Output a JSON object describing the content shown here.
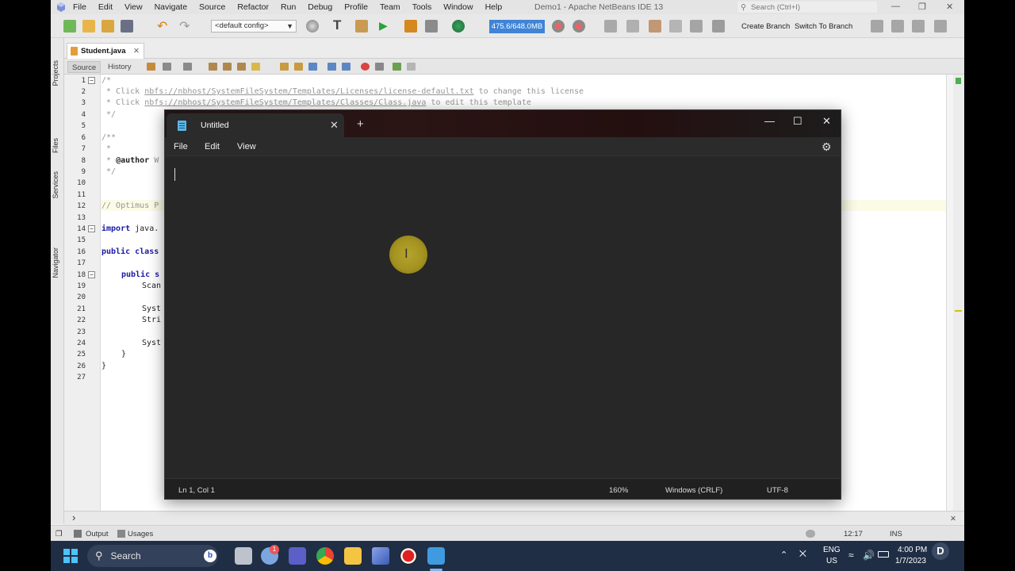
{
  "netbeans": {
    "menus": [
      "File",
      "Edit",
      "View",
      "Navigate",
      "Source",
      "Refactor",
      "Run",
      "Debug",
      "Profile",
      "Team",
      "Tools",
      "Window",
      "Help"
    ],
    "window_title": "Demo1 - Apache NetBeans IDE 13",
    "search_placeholder": "Search (Ctrl+I)",
    "config": "<default config>",
    "memory": "475.6/648.0MB",
    "create_branch": "Create Branch",
    "switch_branch": "Switch To Branch",
    "side_tabs": [
      "Projects",
      "Files",
      "Services",
      "Navigator"
    ],
    "file_tab": "Student.java",
    "source_tab": "Source",
    "history_tab": "History",
    "line_numbers": [
      "1",
      "2",
      "3",
      "4",
      "5",
      "6",
      "7",
      "8",
      "9",
      "10",
      "11",
      "12",
      "13",
      "14",
      "15",
      "16",
      "17",
      "18",
      "19",
      "20",
      "21",
      "22",
      "23",
      "24",
      "25",
      "26",
      "27"
    ],
    "code": {
      "l1": "/*",
      "l2_a": " * Click ",
      "l2_link": "nbfs://nbhost/SystemFileSystem/Templates/Licenses/license-default.txt",
      "l2_b": " to change this license",
      "l3_a": " * Click ",
      "l3_link": "nbfs://nbhost/SystemFileSystem/Templates/Classes/Class.java",
      "l3_b": " to edit this template",
      "l4": " */",
      "l6": "/**",
      "l7": " *",
      "l8_a": " * ",
      "l8_tag": "@author",
      "l8_b": " W",
      "l9": " */",
      "l12": "// Optimus P",
      "l14_kw": "import",
      "l14_b": " java.",
      "l16_kw": "public class",
      "l18_kw": "public s",
      "l19": "Scan",
      "l21": "Syst",
      "l22": "Stri",
      "l24": "Syst",
      "l25": "}",
      "l26": "}"
    },
    "output_tab": "Output",
    "usages_tab": "Usages",
    "caret_pos": "12:17",
    "ins_mode": "INS"
  },
  "notepad": {
    "tab_title": "Untitled",
    "new_tab": "+",
    "menus": [
      "File",
      "Edit",
      "View"
    ],
    "status_position": "Ln 1, Col 1",
    "status_zoom": "160%",
    "status_eol": "Windows (CRLF)",
    "status_encoding": "UTF-8"
  },
  "taskbar": {
    "search_label": "Search",
    "notification_badge": "1",
    "lang_top": "ENG",
    "lang_bottom": "US",
    "time": "4:00 PM",
    "date": "1/7/2023"
  }
}
